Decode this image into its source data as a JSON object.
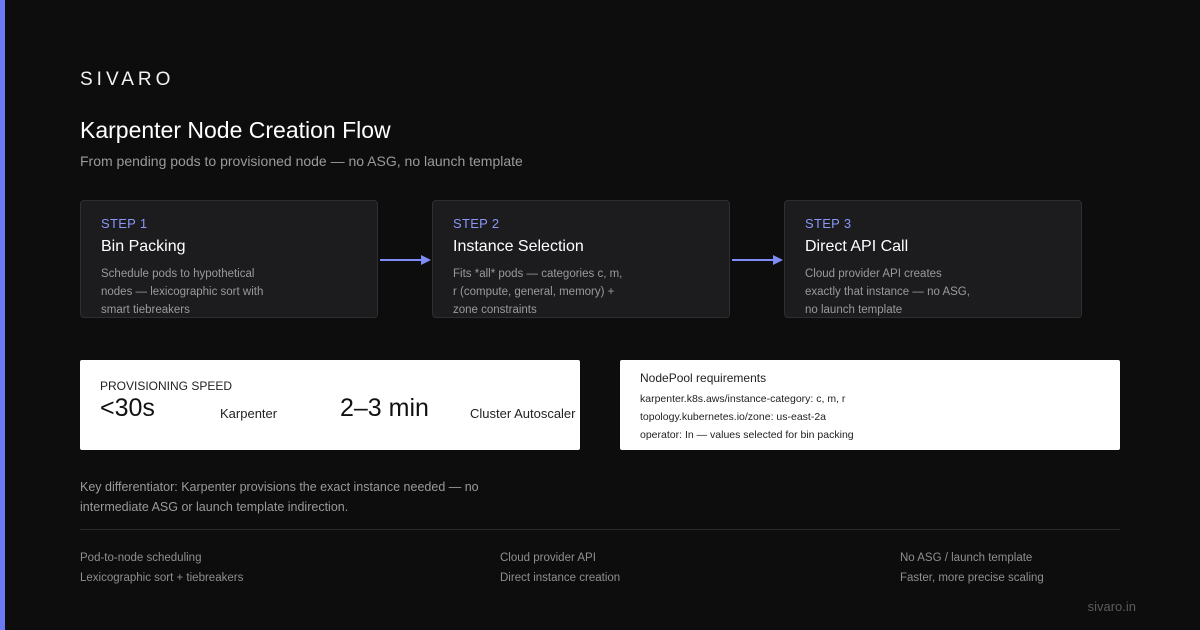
{
  "brand": "SIVARO",
  "title": "Karpenter Node Creation Flow",
  "subtitle": "From pending pods to provisioned node — no ASG, no launch template",
  "steps": [
    {
      "label": "STEP 1",
      "name": "Bin Packing",
      "desc": "Schedule pods to hypothetical nodes — lexicographic sort with smart tiebreakers"
    },
    {
      "label": "STEP 2",
      "name": "Instance Selection",
      "desc": "Fits *all* pods — categories c, m, r (compute, general, memory) + zone constraints"
    },
    {
      "label": "STEP 3",
      "name": "Direct API Call",
      "desc": "Cloud provider API creates exactly that instance — no ASG, no launch template"
    }
  ],
  "speed": {
    "heading": "PROVISIONING SPEED",
    "karpenter_value": "<30s",
    "karpenter_label": "Karpenter",
    "autoscaler_value": "2–3 min",
    "autoscaler_label": "Cluster Autoscaler"
  },
  "nodepool": {
    "heading": "NodePool requirements",
    "lines": [
      "karpenter.k8s.aws/instance-category: c, m, r",
      "topology.kubernetes.io/zone: us-east-2a",
      "operator: In — values selected for bin packing"
    ]
  },
  "differentiator": "Key differentiator: Karpenter provisions the exact instance needed — no intermediate ASG or launch template indirection.",
  "footer": [
    {
      "line1": "Pod-to-node scheduling",
      "line2": "Lexicographic sort + tiebreakers"
    },
    {
      "line1": "Cloud provider API",
      "line2": "Direct instance creation"
    },
    {
      "line1": "No ASG / launch template",
      "line2": "Faster, more precise scaling"
    }
  ],
  "domain": "sivaro.in",
  "colors": {
    "accent": "#6b79f5",
    "background": "#0d0d0d",
    "card": "#1c1c1e"
  }
}
